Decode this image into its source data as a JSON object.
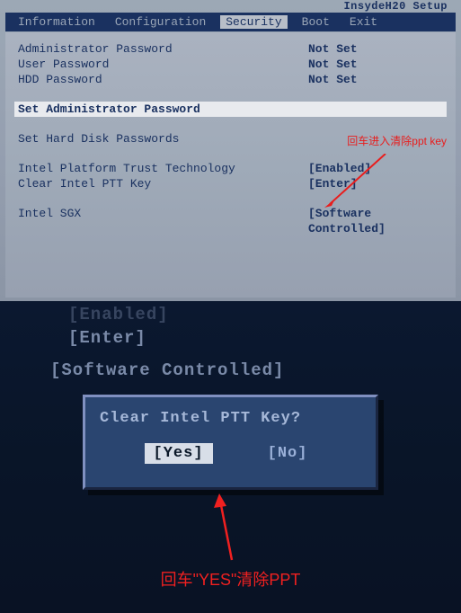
{
  "bios_title": "InsydeH20 Setup",
  "menu": {
    "items": [
      "Information",
      "Configuration",
      "Security",
      "Boot",
      "Exit"
    ],
    "active_index": 2
  },
  "security": {
    "rows": [
      {
        "label": "Administrator Password",
        "value": "Not Set"
      },
      {
        "label": "User Password",
        "value": "Not Set"
      },
      {
        "label": "HDD Password",
        "value": "Not Set"
      }
    ],
    "highlighted": "Set Administrator Password",
    "hdd_link": "Set Hard Disk Passwords",
    "rows2": [
      {
        "label": "Intel Platform Trust Technology",
        "value": "[Enabled]"
      },
      {
        "label": "Clear Intel PTT Key",
        "value": "[Enter]"
      }
    ],
    "rows3": [
      {
        "label": "Intel SGX",
        "value": "[Software Controlled]"
      }
    ]
  },
  "annotation1": "回车进入清除ppt key",
  "bg_line0": "[Enabled]",
  "bg_line1": "[Enter]",
  "bg_line2": "[Software Controlled]",
  "dialog": {
    "title": "Clear Intel PTT Key?",
    "yes": "[Yes]",
    "no": "[No]"
  },
  "annotation2": "回车\"YES\"清除PPT"
}
